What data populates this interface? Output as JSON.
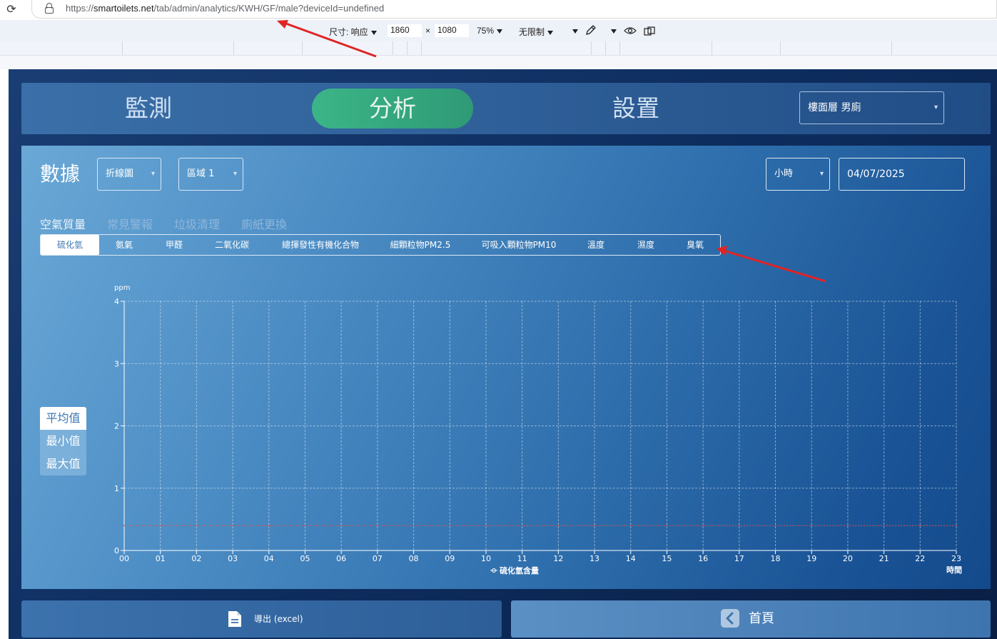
{
  "browser": {
    "url_host": "smartoilets.net",
    "url_prefix": "https://",
    "url_path": "/tab/admin/analytics/KWH/GF/male?deviceId=undefined"
  },
  "devtools": {
    "size_label": "尺寸: 响应",
    "width": "1860",
    "times": "×",
    "height": "1080",
    "zoom": "75%",
    "throttle": "无限制"
  },
  "nav": {
    "tabs": [
      "監測",
      "分析",
      "設置"
    ],
    "active_tab": 1,
    "location_select": "樓面層 男廁"
  },
  "panel": {
    "title": "數據",
    "chart_type_select": "折線圖",
    "zone_select": "區域 1",
    "interval_select": "小時",
    "date": "04/07/2025",
    "categories": [
      "空氣質量",
      "常見警報",
      "垃圾清理",
      "廁紙更換"
    ],
    "active_category": 0,
    "pills": [
      "硫化氫",
      "氨氣",
      "甲醛",
      "二氧化碳",
      "總揮發性有機化合物",
      "細顆粒物PM2.5",
      "可吸入顆粒物PM10",
      "溫度",
      "濕度",
      "臭氧"
    ],
    "active_pill": 0,
    "stats": [
      "平均值",
      "最小值",
      "最大值"
    ],
    "active_stat": 0
  },
  "chart_data": {
    "type": "line",
    "ylabel": "ppm",
    "xlabel": "時間",
    "categories": [
      "00",
      "01",
      "02",
      "03",
      "04",
      "05",
      "06",
      "07",
      "08",
      "09",
      "10",
      "11",
      "12",
      "13",
      "14",
      "15",
      "16",
      "17",
      "18",
      "19",
      "20",
      "21",
      "22",
      "23"
    ],
    "ylim": [
      0,
      4
    ],
    "yticks": [
      "0",
      "1",
      "2",
      "3",
      "4"
    ],
    "grid": true,
    "legend_position": "bottom-center",
    "series": [
      {
        "name": "硫化氫含量",
        "color": "#d9534f",
        "values": [
          0.4,
          0.4,
          0.4,
          0.4,
          0.4,
          0.4,
          0.4,
          0.4,
          0.4,
          0.4,
          0.4,
          0.4,
          0.4,
          0.4,
          0.4,
          0.4,
          0.4,
          0.4,
          0.4,
          0.4,
          0.4,
          0.4,
          0.4,
          0.4
        ]
      }
    ]
  },
  "footer": {
    "export_label": "導出 (excel)",
    "home_label": "首頁"
  },
  "colors": {
    "active_tab": "#3bb587",
    "panel": "#4b8cc4",
    "series_line": "#d9534f"
  }
}
